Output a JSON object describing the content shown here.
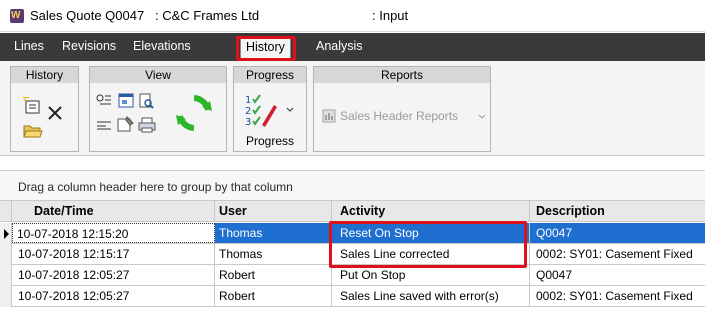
{
  "window": {
    "title": "Sales Quote Q0047   : C&C Frames Ltd",
    "mode": ": Input"
  },
  "tabs": [
    {
      "label": "Lines"
    },
    {
      "label": "Revisions"
    },
    {
      "label": "Elevations"
    },
    {
      "label": "History"
    },
    {
      "label": "Analysis"
    }
  ],
  "ribbon": {
    "groups": [
      {
        "title": "History"
      },
      {
        "title": "View"
      },
      {
        "title": "Progress"
      },
      {
        "title": "Reports"
      }
    ],
    "progress_button_label": "Progress",
    "reports_button_label": "Sales Header Reports"
  },
  "grid": {
    "group_hint": "Drag a column header here to group by that column",
    "columns": [
      "Date/Time",
      "User",
      "Activity",
      "Description"
    ],
    "rows": [
      {
        "datetime": "10-07-2018 12:15:20",
        "user": "Thomas",
        "activity": "Reset On Stop",
        "description": "Q0047"
      },
      {
        "datetime": "10-07-2018 12:15:17",
        "user": "Thomas",
        "activity": "Sales Line corrected",
        "description": "0002: SY01: Casement Fixed"
      },
      {
        "datetime": "10-07-2018 12:05:27",
        "user": "Robert",
        "activity": "Put On Stop",
        "description": "Q0047"
      },
      {
        "datetime": "10-07-2018 12:05:27",
        "user": "Robert",
        "activity": "Sales Line saved with error(s)",
        "description": "0002: SY01: Casement Fixed"
      }
    ]
  },
  "colors": {
    "highlight": "#e0101a",
    "selection": "#1e6fd0",
    "tabbar": "#3a3a3a"
  }
}
